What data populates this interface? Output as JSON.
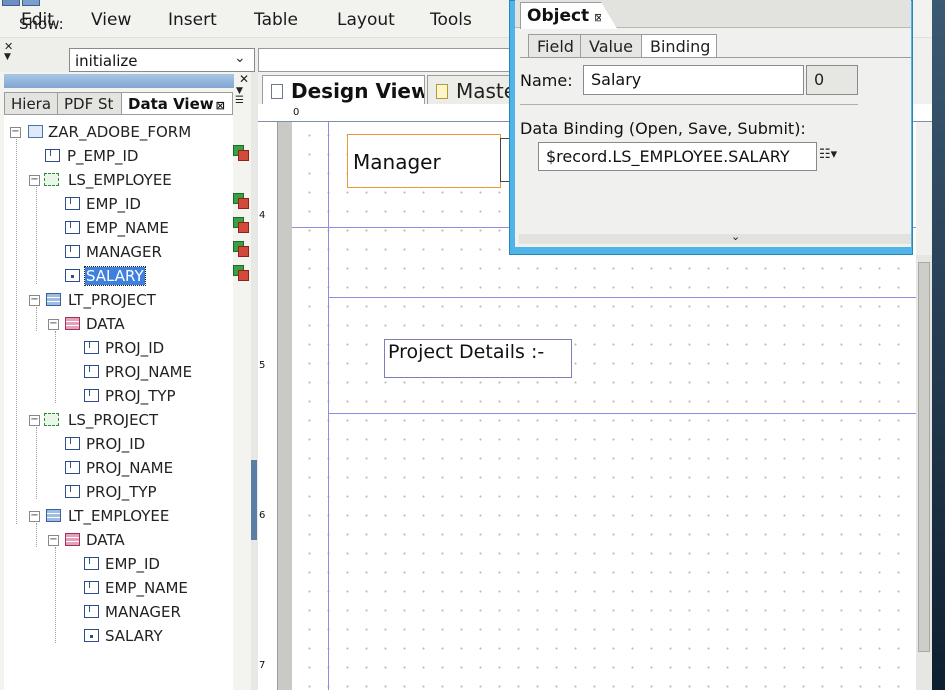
{
  "menu": {
    "items": [
      {
        "label": "Edit",
        "mnemonic": "E"
      },
      {
        "label": "View",
        "mnemonic": "V"
      },
      {
        "label": "Insert",
        "mnemonic": "I"
      },
      {
        "label": "Table",
        "mnemonic": "T"
      },
      {
        "label": "Layout",
        "mnemonic": "L"
      },
      {
        "label": "Tools",
        "mnemonic": "T"
      }
    ]
  },
  "toolbar": {
    "show_label": "Show:",
    "show_value": "initialize"
  },
  "left_panel": {
    "tabs": [
      {
        "label": "Hiera"
      },
      {
        "label": "PDF St"
      },
      {
        "label": "Data View"
      }
    ],
    "tree": [
      {
        "label": "ZAR_ADOBE_FORM",
        "icon": "form-icon"
      },
      {
        "label": "P_EMP_ID",
        "icon": "field-icon"
      },
      {
        "label": "LS_EMPLOYEE",
        "icon": "structure-icon"
      },
      {
        "label": "EMP_ID",
        "icon": "field-icon"
      },
      {
        "label": "EMP_NAME",
        "icon": "field-icon"
      },
      {
        "label": "MANAGER",
        "icon": "field-icon"
      },
      {
        "label": "SALARY",
        "icon": "field-icon",
        "selected": true
      },
      {
        "label": "LT_PROJECT",
        "icon": "table-icon"
      },
      {
        "label": "DATA",
        "icon": "data-row-icon"
      },
      {
        "label": "PROJ_ID",
        "icon": "field-icon"
      },
      {
        "label": "PROJ_NAME",
        "icon": "field-icon"
      },
      {
        "label": "PROJ_TYP",
        "icon": "field-icon"
      },
      {
        "label": "LS_PROJECT",
        "icon": "structure-icon"
      },
      {
        "label": "PROJ_ID",
        "icon": "field-icon"
      },
      {
        "label": "PROJ_NAME",
        "icon": "field-icon"
      },
      {
        "label": "PROJ_TYP",
        "icon": "field-icon"
      },
      {
        "label": "LT_EMPLOYEE",
        "icon": "table-icon"
      },
      {
        "label": "DATA",
        "icon": "data-row-icon"
      },
      {
        "label": "EMP_ID",
        "icon": "field-icon"
      },
      {
        "label": "EMP_NAME",
        "icon": "field-icon"
      },
      {
        "label": "MANAGER",
        "icon": "field-icon"
      },
      {
        "label": "SALARY",
        "icon": "field-icon"
      }
    ]
  },
  "design": {
    "tabs": [
      {
        "label": "Design View"
      },
      {
        "label": "Maste"
      }
    ],
    "ruler": {
      "top_label": "0",
      "left_labels": [
        "4",
        "5",
        "6",
        "7"
      ]
    },
    "canvas": {
      "manager_label": "Manager",
      "project_label": "Project Details :-"
    }
  },
  "object_palette": {
    "title": "Object",
    "tabs": [
      {
        "label": "Field"
      },
      {
        "label": "Value"
      },
      {
        "label": "Binding"
      }
    ],
    "name_label": "Name:",
    "name_value": "Salary",
    "name_index": "0",
    "binding_label": "Data Binding (Open, Save, Submit):",
    "binding_value": "$record.LS_EMPLOYEE.SALARY"
  },
  "colors": {
    "accent_blue": "#3d80df",
    "palette_frame": "#4fb4e8",
    "field_border_selected": "#e89a38",
    "guide_line": "#8c8ee0"
  }
}
